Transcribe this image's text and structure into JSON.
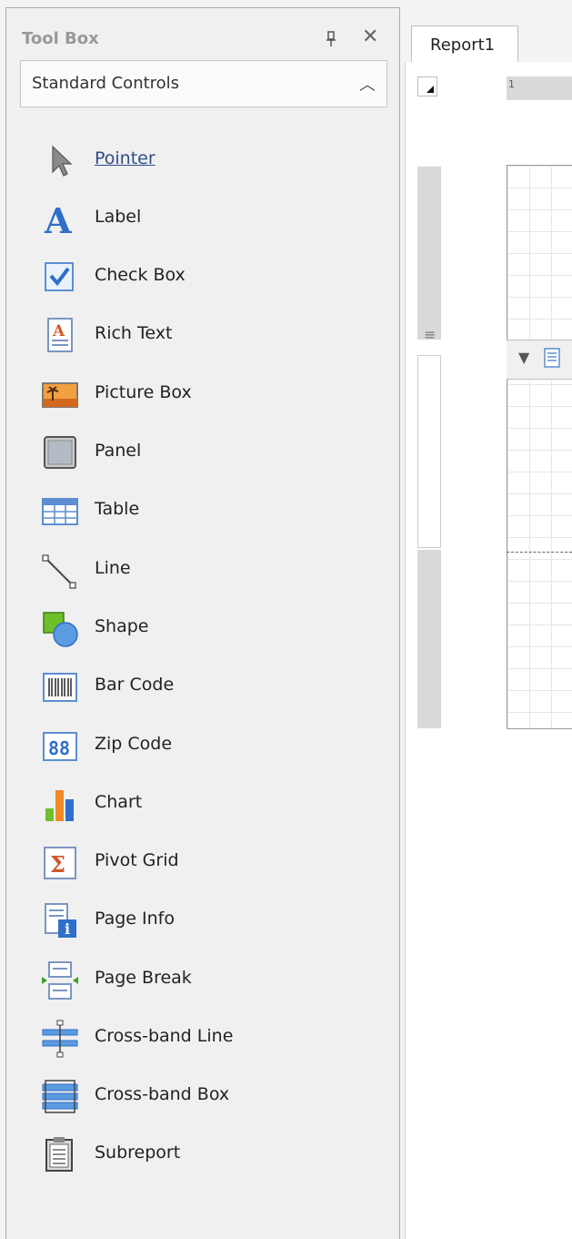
{
  "toolbox": {
    "title": "Tool Box",
    "pin_icon": "pin-icon",
    "close_icon": "close-icon",
    "group": {
      "label": "Standard Controls",
      "caret": "^"
    },
    "items": [
      {
        "label": "Pointer",
        "icon": "pointer-icon"
      },
      {
        "label": "Label",
        "icon": "label-icon"
      },
      {
        "label": "Check Box",
        "icon": "checkbox-icon"
      },
      {
        "label": "Rich Text",
        "icon": "rich-text-icon"
      },
      {
        "label": "Picture Box",
        "icon": "picture-box-icon"
      },
      {
        "label": "Panel",
        "icon": "panel-icon"
      },
      {
        "label": "Table",
        "icon": "table-icon"
      },
      {
        "label": "Line",
        "icon": "line-icon"
      },
      {
        "label": "Shape",
        "icon": "shape-icon"
      },
      {
        "label": "Bar Code",
        "icon": "barcode-icon"
      },
      {
        "label": "Zip Code",
        "icon": "zipcode-icon"
      },
      {
        "label": "Chart",
        "icon": "chart-icon"
      },
      {
        "label": "Pivot Grid",
        "icon": "pivot-grid-icon"
      },
      {
        "label": "Page Info",
        "icon": "page-info-icon"
      },
      {
        "label": "Page Break",
        "icon": "page-break-icon"
      },
      {
        "label": "Cross-band Line",
        "icon": "crossband-line-icon"
      },
      {
        "label": "Cross-band Box",
        "icon": "crossband-box-icon"
      },
      {
        "label": "Subreport",
        "icon": "subreport-icon"
      }
    ]
  },
  "designer": {
    "tab_label": "Report1",
    "ruler_mark": "1",
    "band_arrow": "▼"
  },
  "colors": {
    "accent_blue": "#2f6fc9",
    "link": "#2f4b8a"
  }
}
